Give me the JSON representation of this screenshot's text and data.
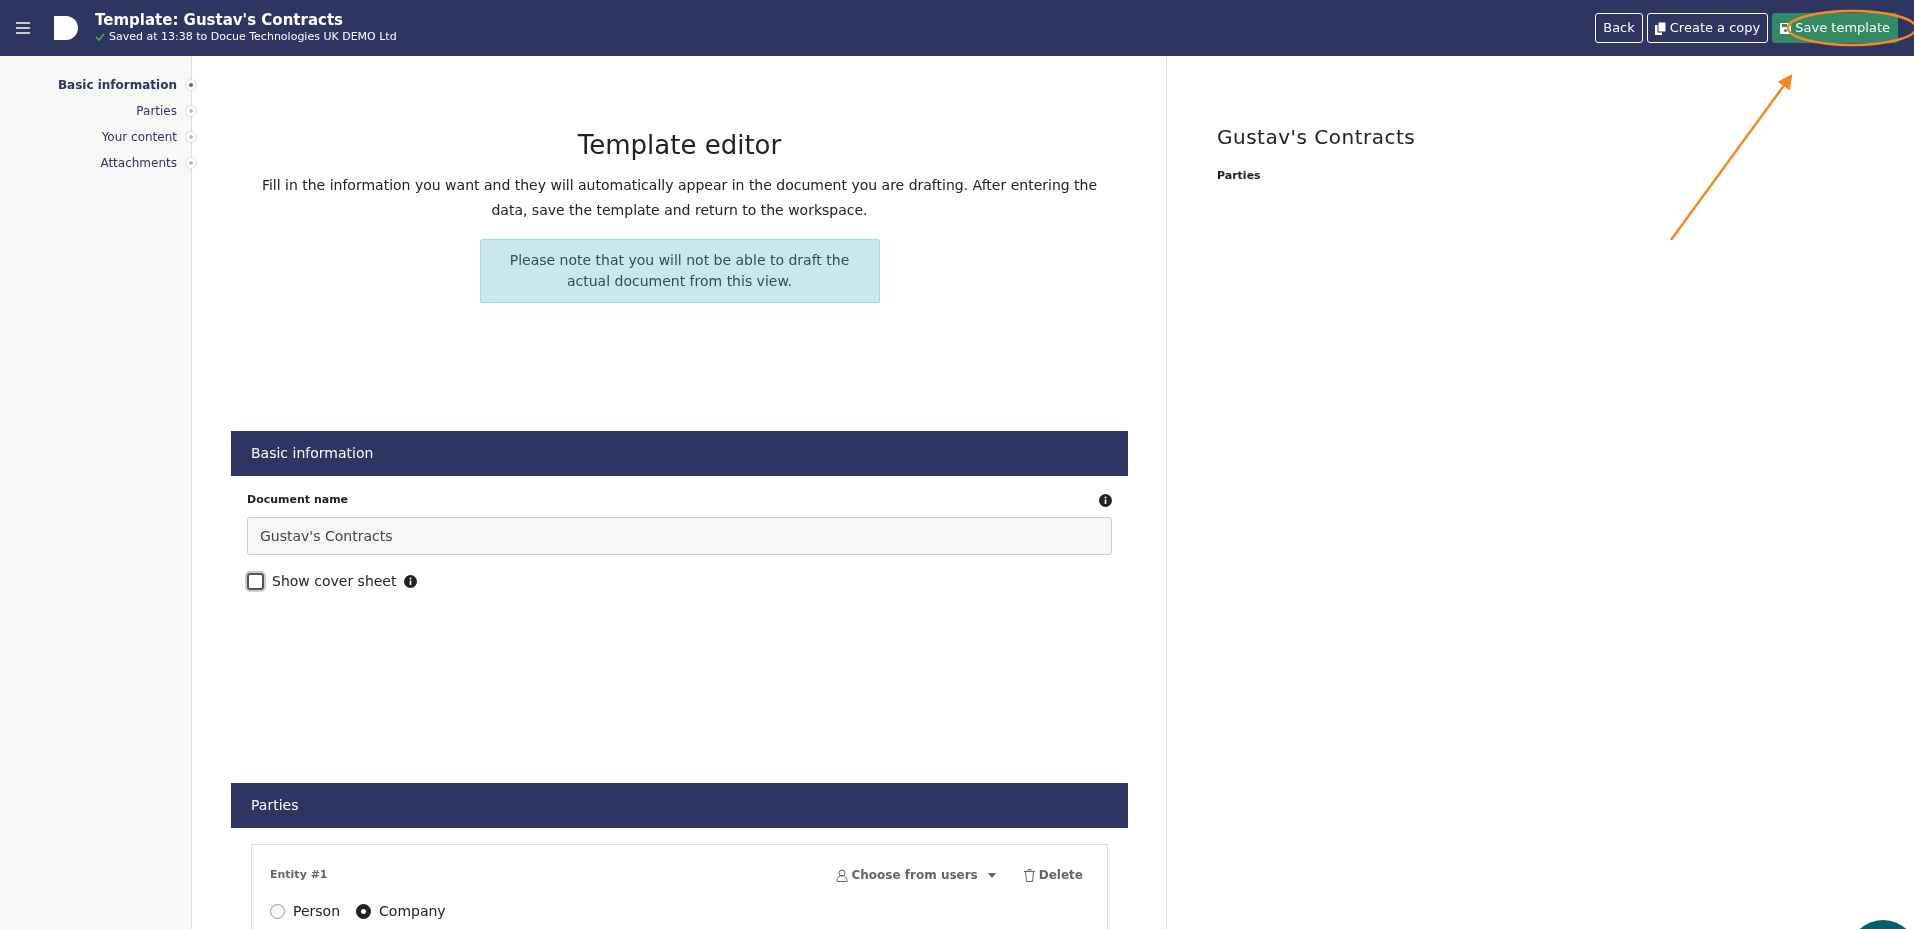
{
  "header": {
    "title": "Template: Gustav's Contracts",
    "status": "Saved at 13:38 to Docue Technologies UK DEMO Ltd",
    "buttons": [
      {
        "label": "Back",
        "kind": "outline"
      },
      {
        "label": "Create a copy",
        "kind": "copy"
      },
      {
        "label": "Save template",
        "kind": "save"
      }
    ]
  },
  "sidebar": {
    "items": [
      {
        "label": "Basic information",
        "selected": true
      },
      {
        "label": "Parties",
        "selected": false
      },
      {
        "label": "Your content",
        "selected": false
      },
      {
        "label": "Attachments",
        "selected": false
      }
    ]
  },
  "editor": {
    "title": "Template editor",
    "intro": "Fill in the information you want and they will automatically appear in the document you are drafting. After entering the data, save the template and return to the workspace.",
    "note": "Please note that you will not be able to draft the actual document from this view."
  },
  "sections": [
    {
      "title": "Basic information",
      "kind": "basic",
      "field": {
        "label": "Document name",
        "value": "Gustav's Contracts"
      },
      "checkbox": {
        "label": "Show cover sheet",
        "checked": false
      }
    },
    {
      "title": "Parties",
      "kind": "parties",
      "entity": {
        "title": "Entity #1",
        "choose": "Choose from users",
        "delete": "Delete",
        "options": [
          {
            "label": "Person",
            "selected": false
          },
          {
            "label": "Company",
            "selected": true
          }
        ]
      }
    }
  ],
  "preview": {
    "title": "Gustav's Contracts",
    "heading": "Parties"
  }
}
